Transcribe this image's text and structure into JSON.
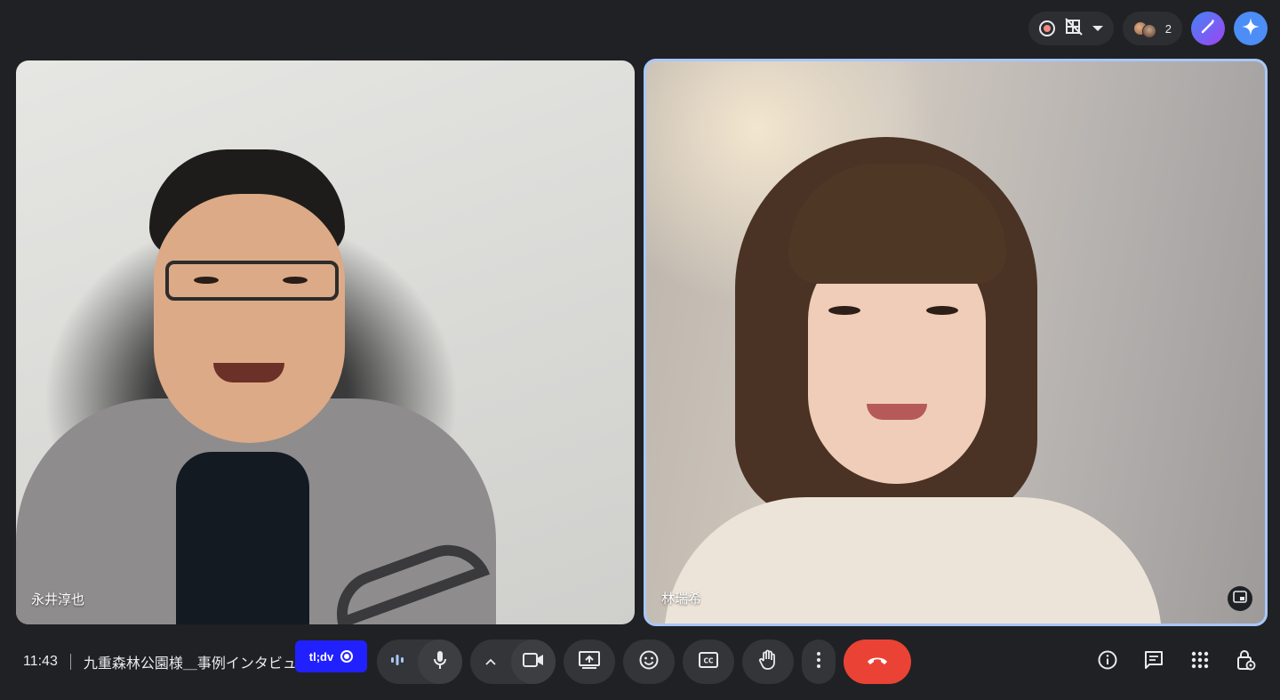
{
  "top_bar": {
    "recording_icon": "record-icon",
    "layout_icon": "no-video-grid-icon",
    "participant_count": "2",
    "notes_icon": "magic-pen-icon",
    "gemini_icon": "sparkle-icon"
  },
  "tiles": [
    {
      "name": "永井淳也",
      "highlighted": false
    },
    {
      "name": "林瑞希",
      "highlighted": true
    }
  ],
  "bottom_bar": {
    "time": "11:43",
    "meeting_title": "九重森林公園様＿事例インタビュー",
    "tldv_label": "tl;dv",
    "controls": [
      "audio-levels-icon",
      "mic-icon",
      "chevron-up-icon",
      "camera-icon",
      "present-icon",
      "emoji-icon",
      "captions-icon",
      "raise-hand-icon",
      "more-vert-icon",
      "hangup-icon"
    ],
    "right_icons": [
      "info-icon",
      "chat-icon",
      "apps-icon",
      "host-controls-icon"
    ]
  },
  "colors": {
    "background": "#202124",
    "control": "#333538",
    "hangup": "#ea4335",
    "active_speaker_border": "#a8c7fa",
    "tldv": "#2121ff"
  }
}
